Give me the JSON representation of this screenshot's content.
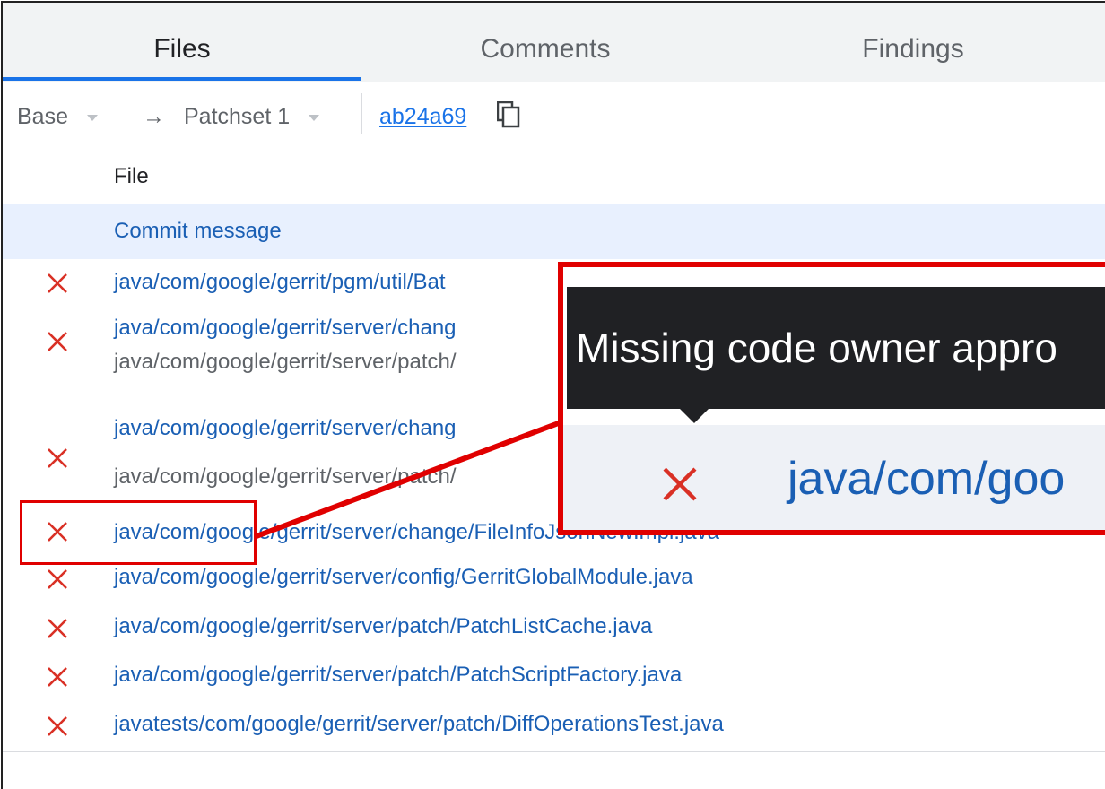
{
  "tabs": [
    {
      "label": "Files"
    },
    {
      "label": "Comments"
    },
    {
      "label": "Findings"
    }
  ],
  "patchset_bar": {
    "base": "Base",
    "arrow": "→",
    "patchset": "Patchset 1",
    "commit_hash": "ab24a69"
  },
  "file_list": {
    "header": "File",
    "commit_message": "Commit message",
    "rows": [
      {
        "lines": [
          "java/com/google/gerrit/pgm/util/Bat"
        ]
      },
      {
        "lines": [
          "java/com/google/gerrit/server/chang",
          "java/com/google/gerrit/server/patch/"
        ]
      },
      {
        "lines": [
          "java/com/google/gerrit/server/chang",
          "java/com/google/gerrit/server/patch/"
        ]
      },
      {
        "lines": [
          "java/com/google/gerrit/server/change/FileInfoJsonNewImpl.java"
        ]
      },
      {
        "lines": [
          "java/com/google/gerrit/server/config/GerritGlobalModule.java"
        ]
      },
      {
        "lines": [
          "java/com/google/gerrit/server/patch/PatchListCache.java"
        ]
      },
      {
        "lines": [
          "java/com/google/gerrit/server/patch/PatchScriptFactory.java"
        ]
      },
      {
        "lines": [
          "javatests/com/google/gerrit/server/patch/DiffOperationsTest.java"
        ]
      }
    ]
  },
  "callout": {
    "tooltip_text": "Missing code owner appro",
    "zoomed_path": "java/com/goo"
  },
  "colors": {
    "accent": "#1a73e8",
    "link": "#1a5fb4",
    "missing_x": "#d93025",
    "highlight": "#e00000",
    "tooltip_bg": "#202124"
  }
}
